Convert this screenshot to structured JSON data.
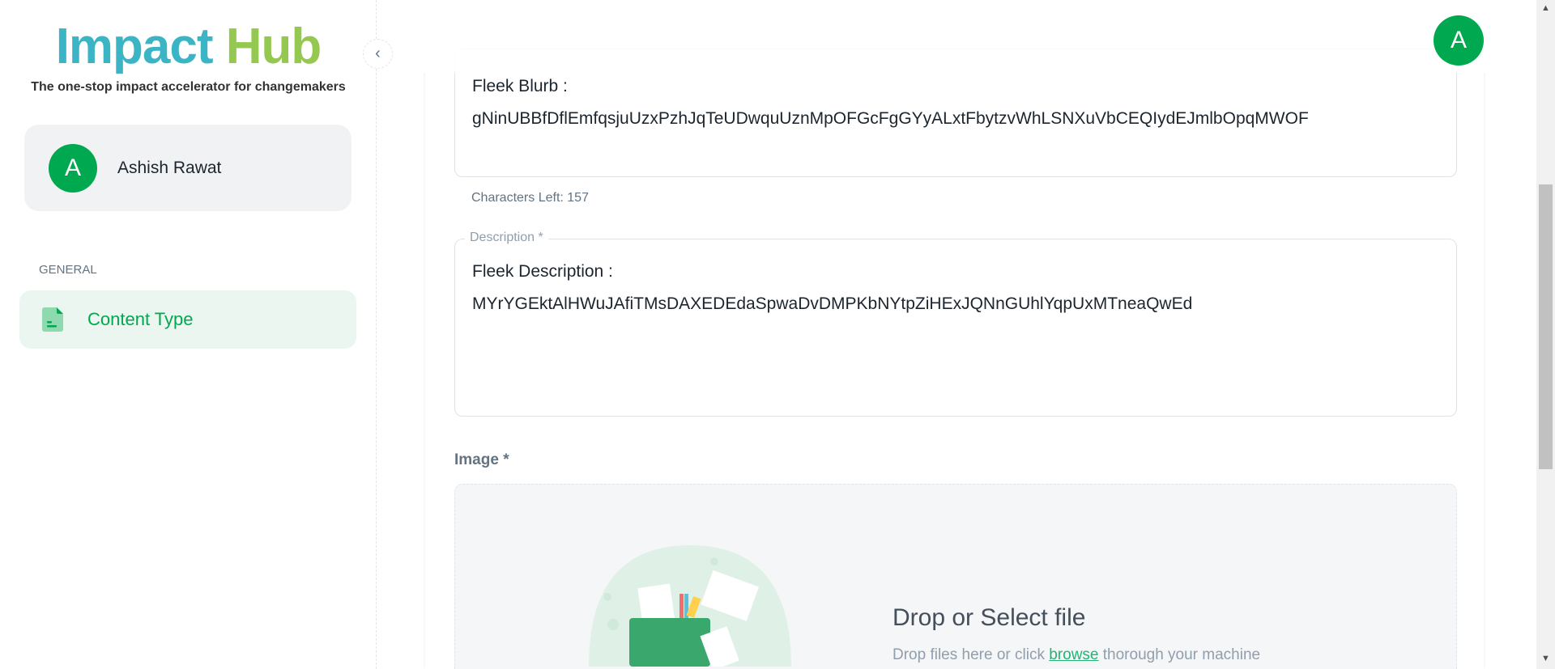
{
  "sidebar": {
    "logo_part1": "Impact",
    "logo_part2": "Hub",
    "tagline": "The one-stop impact accelerator for changemakers",
    "user": {
      "initial": "A",
      "name": "Ashish Rawat"
    },
    "section": "GENERAL",
    "items": [
      {
        "label": "Content Type",
        "icon": "file-icon",
        "active": true
      }
    ]
  },
  "header": {
    "avatar_initial": "A"
  },
  "form": {
    "blurb": {
      "value_line1": "Fleek Blurb :",
      "value_line2": "gNinUBBfDflEmfqsjuUzxPzhJqTeUDwquUznMpOFGcFgGYyALxtFbytzvWhLSNXuVbCEQIydEJmlbOpqMWOF",
      "helper": "Characters Left: 157"
    },
    "description": {
      "label": "Description *",
      "value_line1": "Fleek Description :",
      "value_line2": "MYrYGEktAlHWuJAfiTMsDAXEDEdaSpwaDvDMPKbNYtpZiHExJQNnGUhlYqpUxMTneaQwEd"
    },
    "image": {
      "label": "Image *",
      "drop_title": "Drop or Select file",
      "drop_sub_before": "Drop files here or click ",
      "drop_link": "browse",
      "drop_sub_after": " thorough your machine"
    }
  },
  "colors": {
    "brand_blue": "#3bb5c6",
    "brand_green": "#95c851",
    "accent": "#00a84f"
  }
}
